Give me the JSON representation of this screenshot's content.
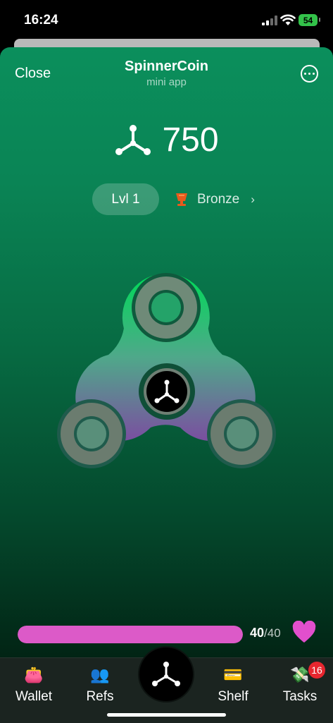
{
  "status": {
    "time": "16:24",
    "battery": "54"
  },
  "header": {
    "close_label": "Close",
    "title": "SpinnerCoin",
    "subtitle": "mini app"
  },
  "balance": {
    "value": "750"
  },
  "level": {
    "label": "Lvl 1",
    "rank": "Bronze"
  },
  "energy": {
    "current": "40",
    "max": "/40",
    "fraction": 1.0
  },
  "nav": {
    "items": [
      {
        "label": "Wallet",
        "icon": "purse-icon"
      },
      {
        "label": "Refs",
        "icon": "people-icon"
      },
      {
        "label": "Shelf",
        "icon": "shelf-icon"
      },
      {
        "label": "Tasks",
        "icon": "money-icon",
        "badge": "16"
      }
    ]
  },
  "colors": {
    "energy_fill": "#dc5ac8",
    "spinner_top": "#00d858",
    "spinner_bottom": "#7a4e9c"
  }
}
